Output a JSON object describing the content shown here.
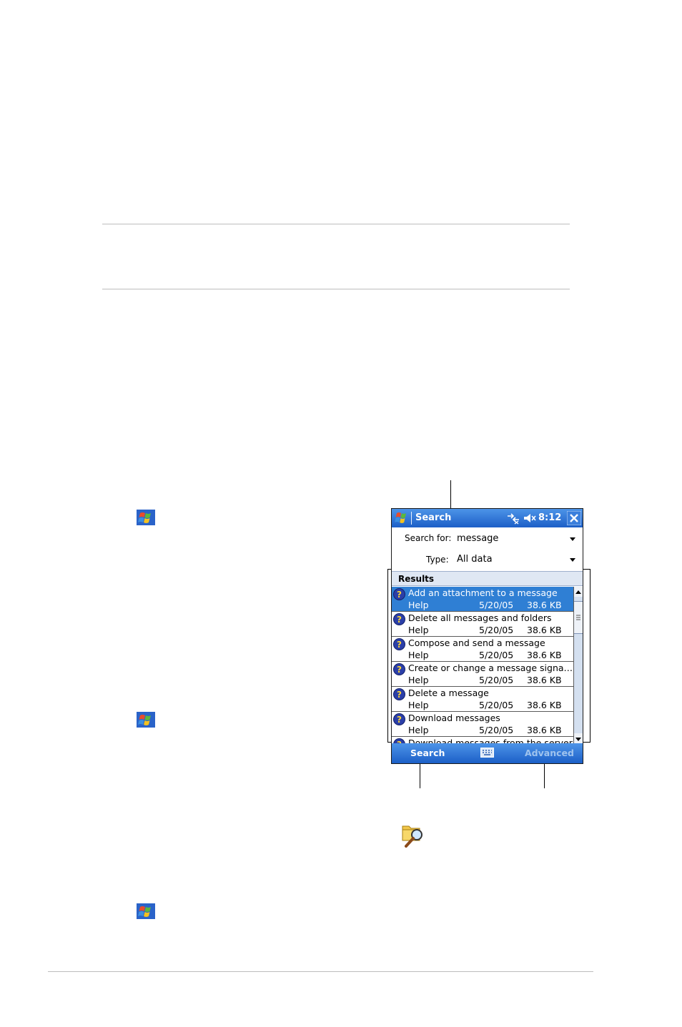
{
  "device": {
    "title": "Search",
    "time": "8:12",
    "search_for_label": "Search for:",
    "search_for_value": "message",
    "type_label": "Type:",
    "type_value": "All data",
    "results_label": "Results",
    "results": [
      {
        "title": "Add an attachment to a message",
        "type": "Help",
        "date": "5/20/05",
        "size": "38.6 KB",
        "selected": true
      },
      {
        "title": "Delete all messages and folders",
        "type": "Help",
        "date": "5/20/05",
        "size": "38.6 KB"
      },
      {
        "title": "Compose and send a message",
        "type": "Help",
        "date": "5/20/05",
        "size": "38.6 KB"
      },
      {
        "title": "Create or change a message signa…",
        "type": "Help",
        "date": "5/20/05",
        "size": "38.6 KB"
      },
      {
        "title": "Delete a message",
        "type": "Help",
        "date": "5/20/05",
        "size": "38.6 KB"
      },
      {
        "title": "Download messages",
        "type": "Help",
        "date": "5/20/05",
        "size": "38.6 KB"
      },
      {
        "title": "Download messages from the server",
        "type": "",
        "date": "",
        "size": ""
      }
    ],
    "menu_left": "Search",
    "menu_right": "Advanced"
  },
  "colors": {
    "titlebar": "#1c5fc7",
    "selection": "#2f7fd4",
    "results_header": "#dfe7f3"
  },
  "icons": [
    "windows-start-icon",
    "search-folder-icon",
    "help-question-icon",
    "keyboard-icon",
    "close-icon",
    "connectivity-icon",
    "speaker-muted-icon"
  ]
}
